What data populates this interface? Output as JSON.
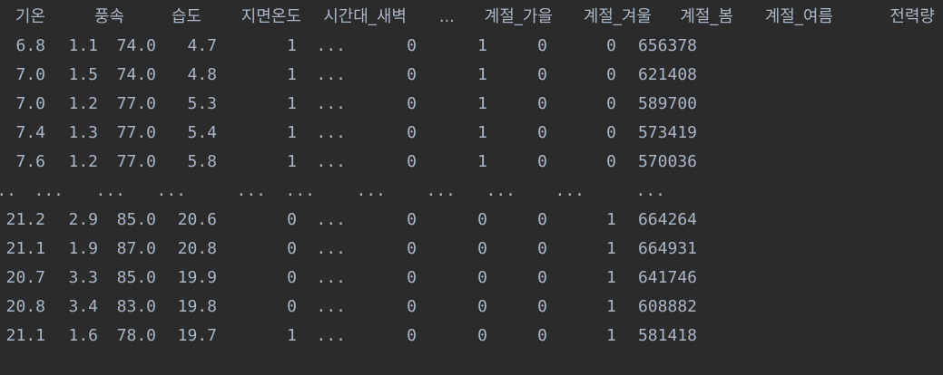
{
  "dataframe": {
    "columns": [
      "기온",
      "풍속",
      "습도",
      "지면온도",
      "시간대_새벽",
      "...",
      "계절_가을",
      "계절_겨울",
      "계절_봄",
      "계절_여름",
      "전력량"
    ],
    "rows_top": [
      [
        "6.8",
        "1.1",
        "74.0",
        "4.7",
        "1",
        "...",
        "0",
        "1",
        "0",
        "0",
        "656378"
      ],
      [
        "7.0",
        "1.5",
        "74.0",
        "4.8",
        "1",
        "...",
        "0",
        "1",
        "0",
        "0",
        "621408"
      ],
      [
        "7.0",
        "1.2",
        "77.0",
        "5.3",
        "1",
        "...",
        "0",
        "1",
        "0",
        "0",
        "589700"
      ],
      [
        "7.4",
        "1.3",
        "77.0",
        "5.4",
        "1",
        "...",
        "0",
        "1",
        "0",
        "0",
        "573419"
      ],
      [
        "7.6",
        "1.2",
        "77.0",
        "5.8",
        "1",
        "...",
        "0",
        "1",
        "0",
        "0",
        "570036"
      ]
    ],
    "ellipsis_row": [
      "..",
      "...",
      "...",
      "...",
      "...",
      "...",
      "...",
      "...",
      "...",
      "...",
      "..."
    ],
    "rows_bottom": [
      [
        "21.2",
        "2.9",
        "85.0",
        "20.6",
        "0",
        "...",
        "0",
        "0",
        "0",
        "1",
        "664264"
      ],
      [
        "21.1",
        "1.9",
        "87.0",
        "20.8",
        "0",
        "...",
        "0",
        "0",
        "0",
        "1",
        "664931"
      ],
      [
        "20.7",
        "3.3",
        "85.0",
        "19.9",
        "0",
        "...",
        "0",
        "0",
        "0",
        "1",
        "641746"
      ],
      [
        "20.8",
        "3.4",
        "83.0",
        "19.8",
        "0",
        "...",
        "0",
        "0",
        "0",
        "1",
        "608882"
      ],
      [
        "21.1",
        "1.6",
        "78.0",
        "19.7",
        "1",
        "...",
        "0",
        "0",
        "0",
        "1",
        "581418"
      ]
    ]
  },
  "theme": {
    "background": "#2b2b2b",
    "text": "#a9b7c6"
  }
}
